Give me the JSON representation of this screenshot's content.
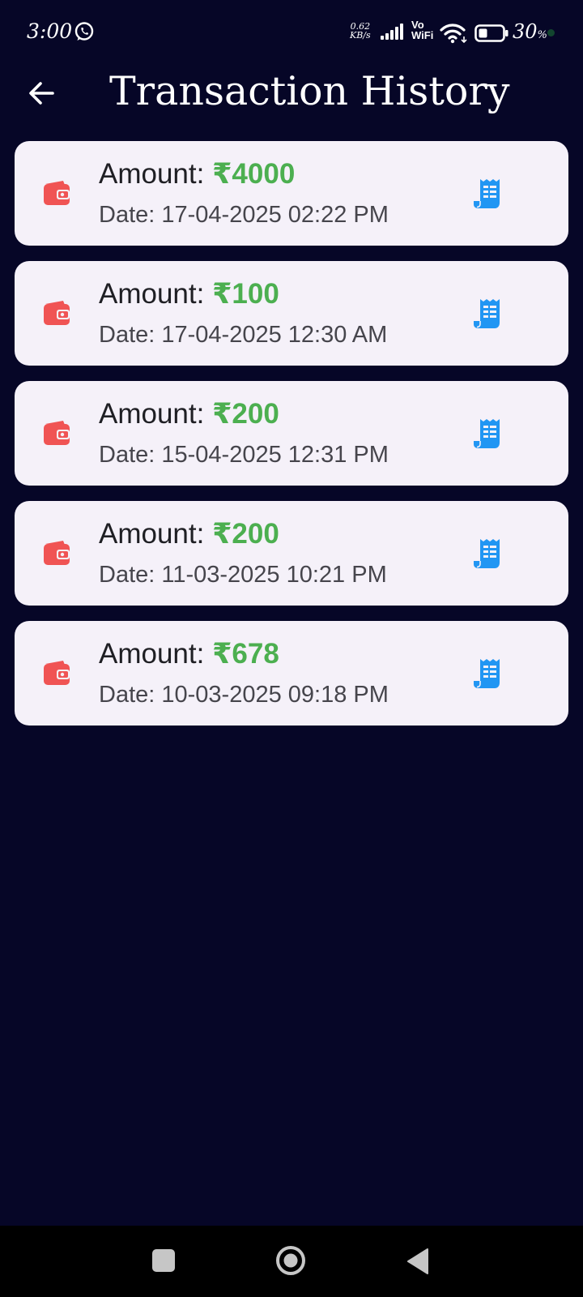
{
  "status_bar": {
    "time": "3:00",
    "network_speed_value": "0.62",
    "network_speed_unit": "KB/s",
    "vowifi_top": "Vo",
    "vowifi_bottom": "WiFi",
    "battery_percent": "30",
    "battery_unit": "%",
    "icons": [
      "whatsapp-icon",
      "signal-icon",
      "wifi-icon",
      "battery-icon"
    ]
  },
  "header": {
    "back_icon": "arrow-left-icon",
    "title": "Transaction History"
  },
  "transactions": [
    {
      "amount_label": "Amount: ",
      "amount": "₹4000",
      "date": "Date: 17-04-2025 02:22 PM"
    },
    {
      "amount_label": "Amount: ",
      "amount": "₹100",
      "date": "Date: 17-04-2025 12:30 AM"
    },
    {
      "amount_label": "Amount: ",
      "amount": "₹200",
      "date": "Date: 15-04-2025 12:31 PM"
    },
    {
      "amount_label": "Amount: ",
      "amount": "₹200",
      "date": "Date: 11-03-2025 10:21 PM"
    },
    {
      "amount_label": "Amount: ",
      "amount": "₹678",
      "date": "Date: 10-03-2025 09:18 PM"
    }
  ],
  "colors": {
    "background": "#060627",
    "card": "#f5f1f9",
    "amount": "#4caf50",
    "wallet_icon": "#f05454",
    "receipt_icon": "#2196f3",
    "text_primary": "#1f1f24",
    "text_secondary": "#46454c"
  },
  "nav_bar": {
    "icons": [
      "recents-square-icon",
      "home-circle-icon",
      "back-triangle-icon"
    ]
  }
}
